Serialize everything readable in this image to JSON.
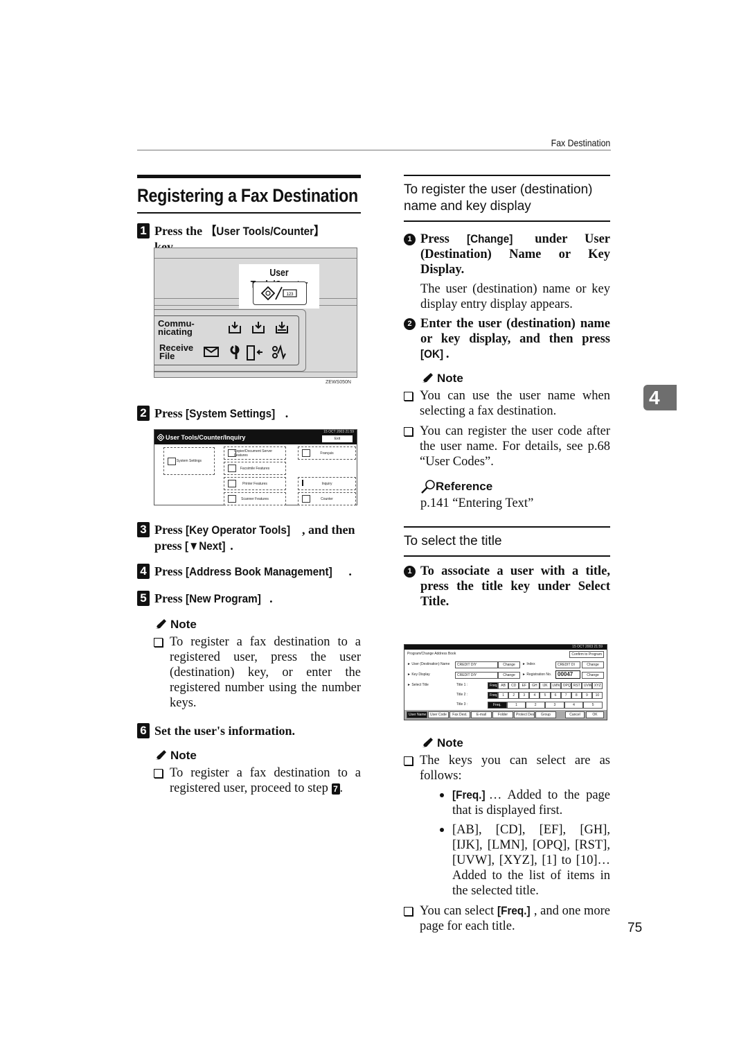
{
  "header": {
    "section_label": "Fax Destination"
  },
  "page_title": "Registering a Fax Destination",
  "chapter_tab": "4",
  "page_number": "75",
  "steps": [
    {
      "num": "1",
      "prefix": "Press the ",
      "key": "【User Tools/Counter】",
      "suffix": " key."
    },
    {
      "num": "2",
      "prefix": "Press ",
      "key": "[System Settings]",
      "suffix": "."
    },
    {
      "num": "3",
      "prefix": "Press ",
      "key": "[Key Operator Tools]",
      "middle": ", and then press ",
      "key2": "[▼Next]",
      "suffix": "."
    },
    {
      "num": "4",
      "prefix": "Press ",
      "key": "[Address Book Management]",
      "suffix": "."
    },
    {
      "num": "5",
      "prefix": "Press ",
      "key": "[New Program]",
      "suffix": "."
    },
    {
      "num": "6",
      "text": "Set the user's information."
    }
  ],
  "note_label": "Note",
  "reference_label": "Reference",
  "step5_note": "To register a fax destination to a registered user, press the user (destination) key, or enter the registered number using the number keys.",
  "step6_note": {
    "text": "To register a fax destination to a registered user, proceed to step ",
    "step_ref": "7",
    "suffix": "."
  },
  "panel1": {
    "key_label": "User Tools/Counter",
    "counter_glyph": "123",
    "comm_label_1": "Commu-",
    "comm_label_2": "nicating",
    "recv_label_1": "Receive",
    "recv_label_2": "File",
    "image_code": "ZEWS050N"
  },
  "panel2": {
    "title": "User Tools/Counter/Inquiry",
    "time": "15 OCT  2003 21:59",
    "exit": "Exit",
    "buttons": [
      {
        "label": "System Settings"
      },
      {
        "label": "Copier/Document Server Features"
      },
      {
        "label": "Facsimile Features"
      },
      {
        "label": "Printer Features"
      },
      {
        "label": "Scanner Features"
      },
      {
        "label": "Français"
      },
      {
        "label": "Inquiry"
      },
      {
        "label": "Counter"
      }
    ]
  },
  "right": {
    "section1_title": "To register the user (destination) name and key display",
    "sub1": {
      "num": "1",
      "prefix": "Press ",
      "key": "[Change]",
      "suffix": " under User (Destination) Name or Key Display."
    },
    "sub1_body": "The user (destination) name or key display entry display appears.",
    "sub2": {
      "num": "2",
      "prefix": "Enter the user (destination) name or key display, and then press ",
      "key": "[OK]",
      "suffix": "."
    },
    "notes1": [
      "You can use the user name when selecting a fax destination.",
      "You can register the user code after the user name. For details, see p.68 “User Codes”."
    ],
    "reference_text": "p.141 “Entering Text”",
    "section2_title": "To select the title",
    "sub3": {
      "num": "1",
      "text": "To associate a user with a title, press the title key under Select Title."
    },
    "notes2_intro": "The keys you can select are as follows:",
    "bullets": [
      {
        "key": "[Freq.]",
        "text": "… Added to the page that is displayed first."
      },
      {
        "text": "[AB], [CD], [EF], [GH], [IJK], [LMN], [OPQ], [RST], [UVW], [XYZ], [1] to [10]… Added to the list of items in the selected title."
      }
    ],
    "note_last": {
      "prefix": "You can select ",
      "key": "[Freq.]",
      "suffix": ", and one more page for each title."
    }
  },
  "panel3": {
    "time": "15 OCT  2003 21:59",
    "title": "Program/Change Address Book",
    "confirm": "Confirm to Program",
    "rows": [
      {
        "label": "► User (Destination) Name",
        "value": "CREDIT DIY",
        "btn": "Change",
        "label2": "► Index",
        "value2": "CREDIT DI",
        "btn2": "Change"
      },
      {
        "label": "► Key Display",
        "value": "CREDIT DIY",
        "btn": "Change",
        "label2": "► Registration No.",
        "value2": "00047",
        "btn2": "Change"
      }
    ],
    "select_title_label": "► Select Title",
    "title_rows": [
      {
        "label": "Title 1 :",
        "keys": [
          "Freq.",
          "AB",
          "CD",
          "EF",
          "GH",
          "IJK",
          "LMN",
          "OPQ",
          "RST",
          "UVW",
          "XYZ"
        ]
      },
      {
        "label": "Title 2 :",
        "keys": [
          "Freq.",
          "1",
          "2",
          "3",
          "4",
          "5",
          "6",
          "7",
          "8",
          "9",
          "10"
        ]
      },
      {
        "label": "Title 3 :",
        "keys": [
          "Freq.",
          "1",
          "2",
          "3",
          "4",
          "5"
        ]
      }
    ],
    "tabs": [
      "User Name",
      "User Code",
      "Fax Dest.",
      "E-mail",
      "Folder",
      "Protect Dest.",
      "Group"
    ],
    "cancel": "Cancel",
    "ok": "OK"
  }
}
